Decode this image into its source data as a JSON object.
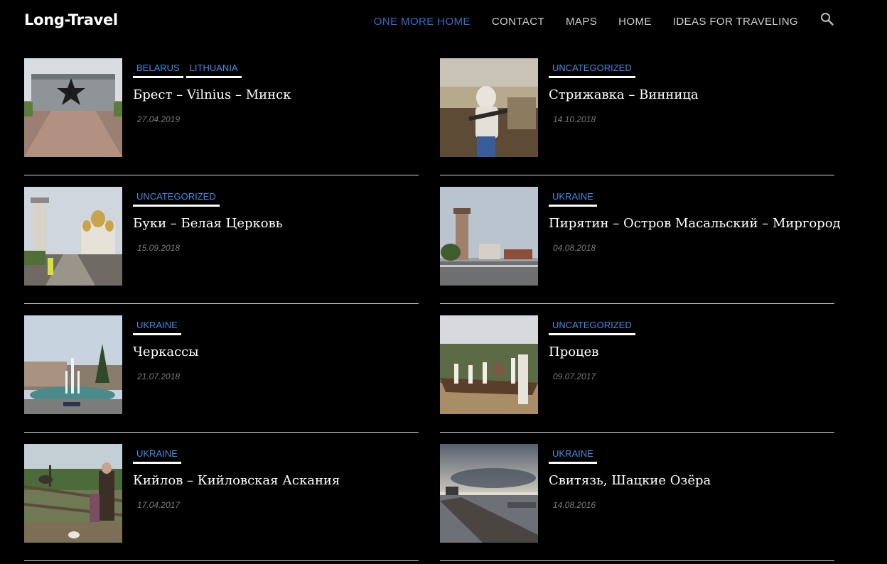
{
  "site": {
    "logo": "Long-Travel"
  },
  "nav": {
    "items": [
      {
        "label": "ONE MORE HOME",
        "active": true
      },
      {
        "label": "CONTACT",
        "active": false
      },
      {
        "label": "MAPS",
        "active": false
      },
      {
        "label": "HOME",
        "active": false
      },
      {
        "label": "IDEAS FOR TRAVELING",
        "active": false
      }
    ],
    "search_icon": "search-icon"
  },
  "colors": {
    "background": "#000000",
    "accent": "#2f6fcf",
    "category": "#3b8ee6",
    "date": "#7a7a7a"
  },
  "posts": [
    {
      "categories": [
        "BELARUS",
        "LITHUANIA"
      ],
      "title": "Брест – Vilnius – Минск",
      "date": "27.04.2019",
      "thumb": "memorial-with-star"
    },
    {
      "categories": [
        "UNCATEGORIZED"
      ],
      "title": "Стрижавка – Винница",
      "date": "14.10.2018",
      "thumb": "child-with-rifle"
    },
    {
      "categories": [
        "UNCATEGORIZED"
      ],
      "title": "Буки – Белая Церковь",
      "date": "15.09.2018",
      "thumb": "church-and-tower"
    },
    {
      "categories": [
        "UKRAINE"
      ],
      "title": "Пирятин – Остров Масальский – Миргород",
      "date": "04.08.2018",
      "thumb": "tower-by-road"
    },
    {
      "categories": [
        "UKRAINE"
      ],
      "title": "Черкассы",
      "date": "21.07.2018",
      "thumb": "fountain"
    },
    {
      "categories": [
        "UNCATEGORIZED"
      ],
      "title": "Процев",
      "date": "09.07.2017",
      "thumb": "boat-with-birds"
    },
    {
      "categories": [
        "UKRAINE"
      ],
      "title": "Кийлов – Кийловская Аскания",
      "date": "17.04.2017",
      "thumb": "ostriches-at-fence"
    },
    {
      "categories": [
        "UKRAINE"
      ],
      "title": "Свитязь, Шацкие Озёра",
      "date": "14.08.2016",
      "thumb": "lake-pier-sunset"
    }
  ]
}
